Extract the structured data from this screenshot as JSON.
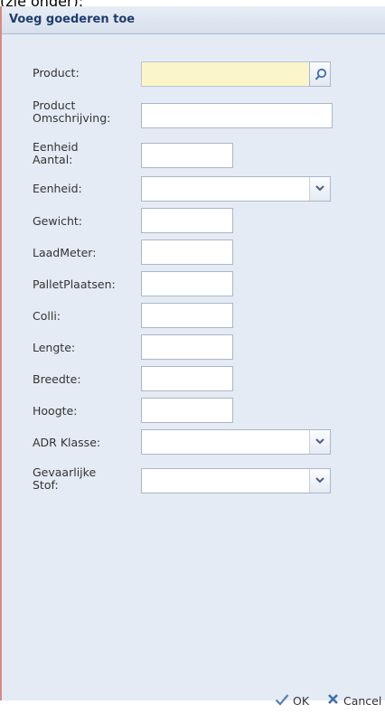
{
  "caption": "(zie onder):",
  "dialog": {
    "title": "Voeg goederen toe"
  },
  "form": {
    "product_label": "Product:",
    "description_label_1": "Product",
    "description_label_2": "Omschrijving:",
    "unit_qty_label_1": "Eenheid",
    "unit_qty_label_2": "Aantal:",
    "unit_label": "Eenheid:",
    "weight_label": "Gewicht:",
    "load_meter_label": "LaadMeter:",
    "pallet_places_label": "PalletPlaatsen:",
    "colli_label": "Colli:",
    "length_label": "Lengte:",
    "width_label": "Breedte:",
    "height_label": "Hoogte:",
    "adr_label": "ADR Klasse:",
    "hazard_label_1": "Gevaarlijke",
    "hazard_label_2": "Stof:"
  },
  "buttons": {
    "ok": "OK",
    "cancel": "Cancel"
  },
  "colors": {
    "title": "#1e3d6f",
    "product_field_bg": "#fbf6c9",
    "panel_bg": "#e5ebf4"
  }
}
